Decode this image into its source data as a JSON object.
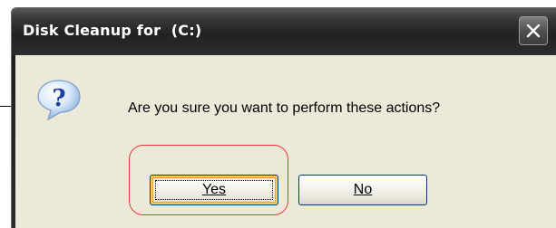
{
  "dialog": {
    "title": "Disk Cleanup for  (C:)",
    "message": "Are you sure you want to perform these actions?",
    "icon": "question-icon",
    "close_icon": "close-icon",
    "buttons": {
      "yes_label": "Yes",
      "no_label": "No"
    }
  },
  "colors": {
    "title_bar": "#222222",
    "dialog_body": "#ece9d8",
    "highlight": "#e03a3a",
    "default_button_glow": "#f7c659"
  }
}
